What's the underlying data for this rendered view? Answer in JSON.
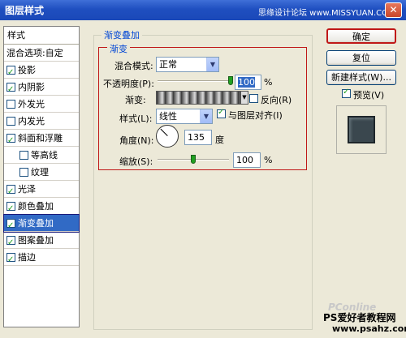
{
  "window": {
    "title": "图层样式",
    "watermark": "思缘设计论坛 www.MISSYUAN.COM",
    "close_glyph": "✕"
  },
  "styles_panel": {
    "header": "样式",
    "blend_options": "混合选项:自定",
    "items": [
      {
        "label": "投影",
        "checked": true
      },
      {
        "label": "内阴影",
        "checked": true
      },
      {
        "label": "外发光",
        "checked": false
      },
      {
        "label": "内发光",
        "checked": false
      },
      {
        "label": "斜面和浮雕",
        "checked": true
      },
      {
        "label": "等高线",
        "checked": false,
        "sub": true
      },
      {
        "label": "纹理",
        "checked": false,
        "sub": true
      },
      {
        "label": "光泽",
        "checked": true
      },
      {
        "label": "颜色叠加",
        "checked": true
      },
      {
        "label": "渐变叠加",
        "checked": true,
        "selected": true
      },
      {
        "label": "图案叠加",
        "checked": true
      },
      {
        "label": "描边",
        "checked": true
      }
    ]
  },
  "gradient_overlay": {
    "section_title": "渐变叠加",
    "subsection_title": "渐变",
    "blend_mode": {
      "label": "混合模式:",
      "value": "正常"
    },
    "opacity": {
      "label": "不透明度(P):",
      "value": "100",
      "unit": "%",
      "level": 1.0
    },
    "gradient": {
      "label": "渐变:",
      "reverse_label": "反向(R)",
      "reverse_checked": false
    },
    "style": {
      "label": "样式(L):",
      "value": "线性",
      "align_label": "与图层对齐(I)",
      "align_checked": true
    },
    "angle": {
      "label": "角度(N):",
      "value": "135",
      "unit": "度"
    },
    "scale": {
      "label": "缩放(S):",
      "value": "100",
      "unit": "%",
      "level": 0.5
    }
  },
  "buttons": {
    "ok": "确定",
    "reset": "复位",
    "new_style": "新建样式(W)...",
    "preview_label": "预览(V)",
    "preview_checked": true
  },
  "logos": {
    "pconline": "PConline",
    "site_name": "PS爱好者教程网",
    "site_url": "www.psahz.com"
  },
  "colors": {
    "accent": "#0046d5",
    "highlight_box": "#c01818",
    "selection": "#316ac5",
    "title_bar": "#1f4fc0"
  }
}
